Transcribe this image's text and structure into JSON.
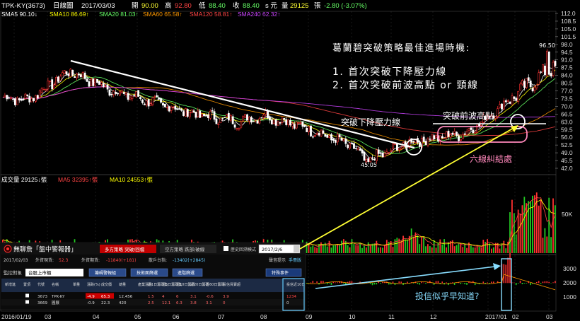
{
  "header": {
    "symbol": "TPK-KY(3673)",
    "period": "日線圖",
    "date": "2017/03/03",
    "open_label": "開",
    "open": "90.00",
    "high_label": "高",
    "high": "92.80",
    "low_label": "低",
    "low": "88.40",
    "close_label": "收",
    "close": "88.40",
    "close_suffix": "s 元",
    "volume_label": "量",
    "volume": "29125",
    "volume_unit": "張",
    "change": "-2.80 (-3.07%)"
  },
  "ma_legend": [
    {
      "label": "SMA5",
      "value": "90.10",
      "arrow": "↓",
      "color": "#ffffff"
    },
    {
      "label": "SMA10",
      "value": "86.69",
      "arrow": "↑",
      "color": "#ffff00"
    },
    {
      "label": "SMA20",
      "value": "81.03",
      "arrow": "↑",
      "color": "#66ff66"
    },
    {
      "label": "SMA60",
      "value": "65.58",
      "arrow": "↑",
      "color": "#ff9900"
    },
    {
      "label": "SMA120",
      "value": "58.81",
      "arrow": "↑",
      "color": "#ff4444"
    },
    {
      "label": "SMA240",
      "value": "62.32",
      "arrow": "↑",
      "color": "#cc44ff"
    }
  ],
  "vol_legend": [
    {
      "label": "成交量",
      "value": "29125",
      "arrow": "↓",
      "unit": "張",
      "color": "#ffffff"
    },
    {
      "label": "MA5",
      "value": "32395",
      "arrow": "↑",
      "unit": "張",
      "color": "#ff4444"
    },
    {
      "label": "MA10",
      "value": "24553",
      "arrow": "↑",
      "unit": "張",
      "color": "#ffff00"
    }
  ],
  "annotations": {
    "title": "葛蘭碧突破策略最佳進場時機:",
    "item1": "1. 首次突破下降壓力線",
    "item2": "2. 首次突破前波高點 or 頸線",
    "breakout_label": "突破下降壓力線",
    "prev_high_label": "突破前波高點",
    "six_ma_label": "六線糾結處",
    "trust_label": "投信似乎早知道?",
    "low_label": "45.05",
    "high_label": "96.50"
  },
  "overlay": {
    "logo": "無聊詹「盤中警報器」",
    "tab1": "多方策略 突破/回檔",
    "tab2": "空方策略 跌部/破線",
    "history_label": "歷史回溯模式",
    "history_date": "2017/2/6",
    "date": "2017/02/03",
    "foreign_label": "外資現貨:",
    "foreign_value": "52.3",
    "foreign_fut_label": "外資期貨:",
    "foreign_fut_value": "-11840(+181)",
    "retail_label": "散戶台指:",
    "retail_value": "-13402(+2845)",
    "monitor_label": "監控對象",
    "monitor_value": "台股上市櫃",
    "btn1": "籌碼警報組",
    "btn2": "技術面篩選",
    "btn3": "進階篩選",
    "sound_label": "聲音提示",
    "manual_label": "手冊版",
    "special_btn": "特殊事件",
    "columns": [
      "新增進",
      "置頂",
      "代號",
      "名稱",
      "單量",
      "漲跌(%)",
      "成交價",
      "總量",
      "產業漲跌",
      "近1日籌碼集中度",
      "近5日籌碼集中度",
      "近10日籌碼集中度",
      "近20日籌碼集中度",
      "近60日籌碼集中度",
      "投信買賣超",
      "投信近10日買賣超"
    ],
    "rows": [
      [
        "",
        "",
        "3673",
        "TPK-KY",
        "",
        "-4.9",
        "65.3",
        "12,456",
        "",
        "1.5",
        "4",
        "6",
        "3.1",
        "-0.6",
        "3.9",
        "1234"
      ],
      [
        "",
        "",
        "3669",
        "圓展",
        "",
        "-0.9",
        "22.3",
        "420",
        "",
        "2.5",
        "12.1",
        "6.3",
        "3.8",
        "3.1",
        "0",
        "0"
      ]
    ]
  },
  "x_axis": [
    "2016/01/19",
    "03",
    "04",
    "05",
    "06",
    "07",
    "08",
    "09",
    "10",
    "11",
    "12",
    "2017/01",
    "02",
    "03"
  ],
  "chart_data": [
    {
      "type": "candlestick",
      "title": "TPK-KY(3673) 日線圖",
      "ylim": [
        42.5,
        112.0
      ],
      "yticks": [
        "112.0",
        "108.5",
        "105.0",
        "101.5",
        "98.0",
        "94.5",
        "91.0",
        "87.5",
        "84.0",
        "80.5",
        "77.0",
        "73.5",
        "70.0",
        "66.5",
        "63.0",
        "59.5",
        "56.0",
        "52.5",
        "49.0",
        "45.5",
        "42.0"
      ],
      "months": [
        "2016/01/19",
        "03",
        "04",
        "05",
        "06",
        "07",
        "08",
        "09",
        "10",
        "11",
        "12",
        "2017/01",
        "02",
        "03"
      ],
      "price_path": [
        {
          "month": "2016/01",
          "close": 74
        },
        {
          "month": "02",
          "close": 73
        },
        {
          "month": "03",
          "close": 86
        },
        {
          "month": "04",
          "close": 77
        },
        {
          "month": "05",
          "close": 72
        },
        {
          "month": "06",
          "close": 67
        },
        {
          "month": "07",
          "close": 63
        },
        {
          "month": "08",
          "close": 66
        },
        {
          "month": "09",
          "close": 60
        },
        {
          "month": "10",
          "close": 52
        },
        {
          "month": "11",
          "close": 45.05
        },
        {
          "month": "12",
          "close": 54
        },
        {
          "month": "2017/01",
          "close": 58
        },
        {
          "month": "02",
          "close": 75
        },
        {
          "month": "03",
          "close": 88.4
        }
      ],
      "period_low": 45.05,
      "period_high": 96.5,
      "last": {
        "open": 90.0,
        "high": 92.8,
        "low": 88.4,
        "close": 88.4
      }
    },
    {
      "type": "bar",
      "title": "成交量",
      "ytick_label": "50K",
      "last_volume": 29125,
      "ma5": 32395,
      "ma10": 24553
    },
    {
      "type": "bar",
      "title": "投信買賣超",
      "yticks": [
        "3000",
        "2000",
        "1000"
      ]
    }
  ],
  "colors": {
    "up": "#ff3030",
    "down": "#ffffff",
    "vol_up": "#ff3030",
    "vol_down": "#22cc22",
    "trend_line": "#ffffff",
    "arrow": "#ffff33",
    "pink": "#ff88bb",
    "cyan": "#88ddff"
  }
}
